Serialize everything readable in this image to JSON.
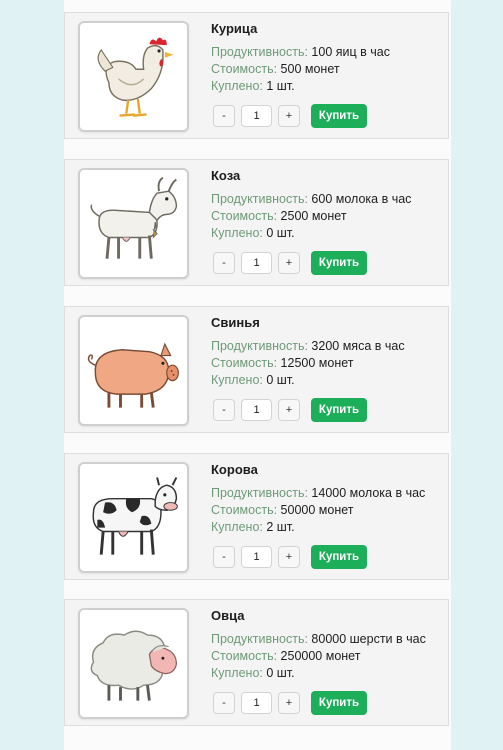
{
  "theme": {
    "background": "#e1f2f4",
    "label_color": "#6f9a78",
    "buy_color": "#1dae59"
  },
  "animals": [
    {
      "id": "chicken",
      "name": "Курица",
      "prod_label": "Продуктивность:",
      "prod_value": "100 яиц в час",
      "cost_label": "Стоимость:",
      "cost_value": "500 монет",
      "bought_label": "Куплено:",
      "bought_value": "1 шт.",
      "minus": "-",
      "qty": "1",
      "plus": "+",
      "buy": "Купить",
      "icon": "chicken-icon"
    },
    {
      "id": "goat",
      "name": "Коза",
      "prod_label": "Продуктивность:",
      "prod_value": "600 молока в час",
      "cost_label": "Стоимость:",
      "cost_value": "2500 монет",
      "bought_label": "Куплено:",
      "bought_value": "0 шт.",
      "minus": "-",
      "qty": "1",
      "plus": "+",
      "buy": "Купить",
      "icon": "goat-icon"
    },
    {
      "id": "pig",
      "name": "Свинья",
      "prod_label": "Продуктивность:",
      "prod_value": "3200 мяса в час",
      "cost_label": "Стоимость:",
      "cost_value": "12500 монет",
      "bought_label": "Куплено:",
      "bought_value": "0 шт.",
      "minus": "-",
      "qty": "1",
      "plus": "+",
      "buy": "Купить",
      "icon": "pig-icon"
    },
    {
      "id": "cow",
      "name": "Корова",
      "prod_label": "Продуктивность:",
      "prod_value": "14000 молока в час",
      "cost_label": "Стоимость:",
      "cost_value": "50000 монет",
      "bought_label": "Куплено:",
      "bought_value": "2 шт.",
      "minus": "-",
      "qty": "1",
      "plus": "+",
      "buy": "Купить",
      "icon": "cow-icon"
    },
    {
      "id": "sheep",
      "name": "Овца",
      "prod_label": "Продуктивность:",
      "prod_value": "80000 шерсти в час",
      "cost_label": "Стоимость:",
      "cost_value": "250000 монет",
      "bought_label": "Куплено:",
      "bought_value": "0 шт.",
      "minus": "-",
      "qty": "1",
      "plus": "+",
      "buy": "Купить",
      "icon": "sheep-icon"
    }
  ]
}
